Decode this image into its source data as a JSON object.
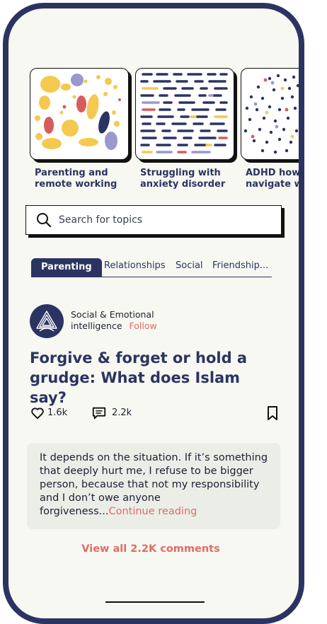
{
  "topics": [
    {
      "caption_line1": "Parenting and",
      "caption_line2": "remote working"
    },
    {
      "caption_line1": "Struggling with",
      "caption_line2": "anxiety disorder"
    },
    {
      "caption_line1": "ADHD how to",
      "caption_line2": "navigate wh"
    }
  ],
  "search": {
    "placeholder": "Search for topics"
  },
  "tabs": [
    "Parenting",
    "Relationships",
    "Social",
    "Friendship..."
  ],
  "post": {
    "author_line1": "Social & Emotional",
    "author_line2": "intelligence",
    "follow_label": "Follow",
    "title": "Forgive & forget or hold a grudge: What does Islam say?",
    "likes": "1.6k",
    "comments": "2.2k"
  },
  "top_comment": {
    "text": "It depends on the situation. If it’s something that deeply hurt me, I refuse to be bigger person, because that not my responsibility and I don’t owe anyone forgiveness...",
    "continue_label": "Continue reading"
  },
  "view_all_label": "View all 2.2K comments",
  "colors": {
    "navy": "#2b3461",
    "coral": "#e36a68",
    "yellow": "#f5c94f",
    "lavender": "#9b98cc",
    "background": "#f6f8f1"
  }
}
